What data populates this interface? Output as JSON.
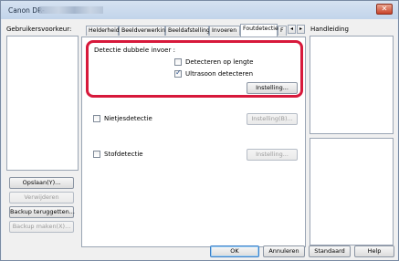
{
  "title": "Canon DR-",
  "user_prefs": {
    "label": "Gebruikersvoorkeur:",
    "buttons": {
      "save": "Opslaan(Y)...",
      "delete": "Verwijderen",
      "backup_restore": "Backup teruggetten...",
      "backup_make": "Backup maken(X)..."
    }
  },
  "tabs": [
    "Helderheid",
    "Beeldverwerking",
    "Beeldafstelling",
    "Invoeren",
    "Foutdetectie",
    "F"
  ],
  "help_label": "Handleiding",
  "double_feed": {
    "label": "Detectie dubbele invoer :",
    "by_length": "Detecteren op lengte",
    "by_length_checked": false,
    "ultrasonic": "Ultrasoon detecteren",
    "ultrasonic_checked": true,
    "settings": "Instelling..."
  },
  "staple": {
    "label": "Nietjesdetectie",
    "checked": false,
    "settings": "Instelling(B)..."
  },
  "dust": {
    "label": "Stofdetectie",
    "checked": false,
    "settings": "Instelling..."
  },
  "footer": {
    "ok": "OK",
    "cancel": "Annuleren",
    "default": "Standaard",
    "help": "Help"
  },
  "colors": {
    "highlight": "#d7193b"
  }
}
